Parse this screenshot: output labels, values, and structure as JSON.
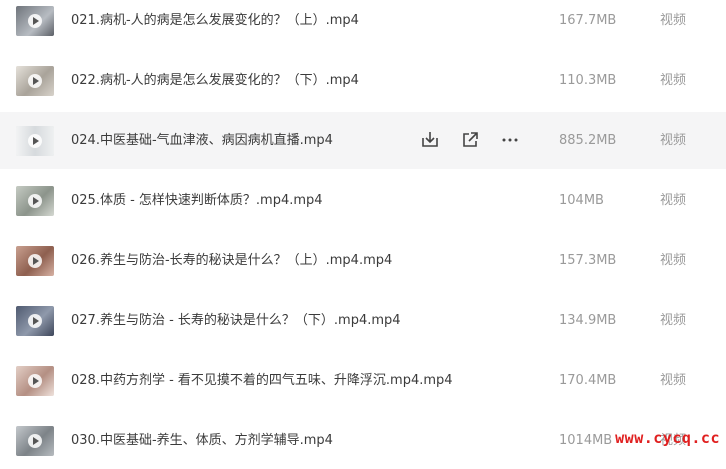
{
  "files": [
    {
      "name": "021.病机-人的病是怎么发展变化的？（上）.mp4",
      "size": "167.7MB",
      "type": "视频",
      "thumb_color": "#8a8f96"
    },
    {
      "name": "022.病机-人的病是怎么发展变化的？（下）.mp4",
      "size": "110.3MB",
      "type": "视频",
      "thumb_color": "#b9b4ac"
    },
    {
      "name": "024.中医基础-气血津液、病因病机直播.mp4",
      "size": "885.2MB",
      "type": "视频",
      "thumb_color": "#e6e8ea"
    },
    {
      "name": "025.体质 - 怎样快速判断体质？.mp4.mp4",
      "size": "104MB",
      "type": "视频",
      "thumb_color": "#a9b0a7"
    },
    {
      "name": "026.养生与防治-长寿的秘诀是什么？（上）.mp4.mp4",
      "size": "157.3MB",
      "type": "视频",
      "thumb_color": "#b48a7a"
    },
    {
      "name": "027.养生与防治 - 长寿的秘诀是什么？（下）.mp4.mp4",
      "size": "134.9MB",
      "type": "视频",
      "thumb_color": "#6f7a90"
    },
    {
      "name": "028.中药方剂学 - 看不见摸不着的四气五味、升降浮沉.mp4.mp4",
      "size": "170.4MB",
      "type": "视频",
      "thumb_color": "#c9b2a8"
    },
    {
      "name": "030.中医基础-养生、体质、方剂学辅导.mp4",
      "size": "1014MB",
      "type": "视频",
      "thumb_color": "#9ea3a8"
    }
  ],
  "hover_actions": {
    "download_icon": "download-icon",
    "share_icon": "share-icon",
    "more_icon": "more-icon"
  },
  "watermark": "www.cycq.cc"
}
